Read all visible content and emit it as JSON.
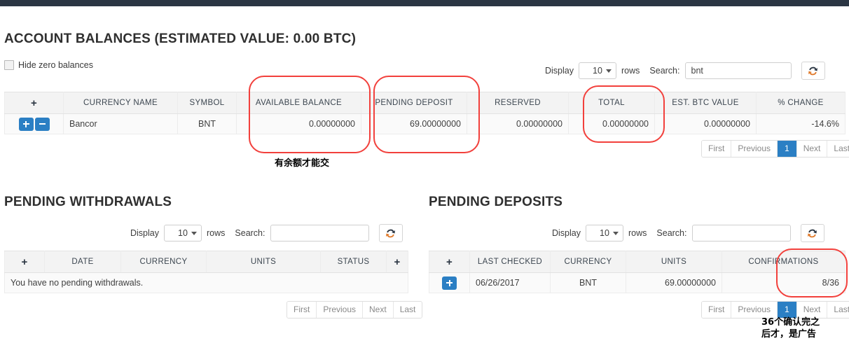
{
  "topbar": {
    "color": "#2b3643"
  },
  "accent_color": "#2b7fc4",
  "annotation_color": "#f2403c",
  "account_balances": {
    "heading": "ACCOUNT BALANCES (ESTIMATED VALUE: 0.00 BTC)",
    "hide_zero_label": "Hide zero balances",
    "hide_zero_checked": false,
    "controls": {
      "display_label": "Display",
      "rows_value": "10",
      "rows_label": "rows",
      "search_label": "Search:",
      "search_value": "bnt",
      "search_placeholder": "",
      "refresh_icon": "refresh-icon"
    },
    "columns": [
      "+",
      "CURRENCY NAME",
      "SYMBOL",
      "AVAILABLE BALANCE",
      "PENDING DEPOSIT",
      "RESERVED",
      "TOTAL",
      "EST. BTC VALUE",
      "% CHANGE"
    ],
    "rows": [
      {
        "expand_button": "+",
        "collapse_button": "−",
        "currency_name": "Bancor",
        "symbol": "BNT",
        "available_balance": "0.00000000",
        "pending_deposit": "69.00000000",
        "reserved": "0.00000000",
        "total": "0.00000000",
        "est_btc_value": "0.00000000",
        "percent_change": "-14.6%"
      }
    ],
    "pagination": {
      "first": "First",
      "previous": "Previous",
      "current": "1",
      "next": "Next",
      "last": "Last"
    }
  },
  "pending_withdrawals": {
    "heading": "PENDING WITHDRAWALS",
    "controls": {
      "display_label": "Display",
      "rows_value": "10",
      "rows_label": "rows",
      "search_label": "Search:",
      "search_value": "",
      "search_placeholder": "",
      "refresh_icon": "refresh-icon"
    },
    "columns": [
      "+",
      "DATE",
      "CURRENCY",
      "UNITS",
      "STATUS",
      "+"
    ],
    "empty_message": "You have no pending withdrawals.",
    "pagination": {
      "first": "First",
      "previous": "Previous",
      "next": "Next",
      "last": "Last"
    }
  },
  "pending_deposits": {
    "heading": "PENDING DEPOSITS",
    "controls": {
      "display_label": "Display",
      "rows_value": "10",
      "rows_label": "rows",
      "search_label": "Search:",
      "search_value": "",
      "search_placeholder": "",
      "refresh_icon": "refresh-icon"
    },
    "columns": [
      "+",
      "LAST CHECKED",
      "CURRENCY",
      "UNITS",
      "CONFIRMATIONS"
    ],
    "rows": [
      {
        "expand_button": "+",
        "last_checked": "06/26/2017",
        "currency": "BNT",
        "units": "69.00000000",
        "confirmations": "8/36"
      }
    ],
    "pagination": {
      "first": "First",
      "previous": "Previous",
      "current": "1",
      "next": "Next",
      "last": "Last"
    }
  },
  "annotations": {
    "balance_note": "有余额才能交",
    "confirmations_note": "36个确认完之\n后才，是广告"
  }
}
